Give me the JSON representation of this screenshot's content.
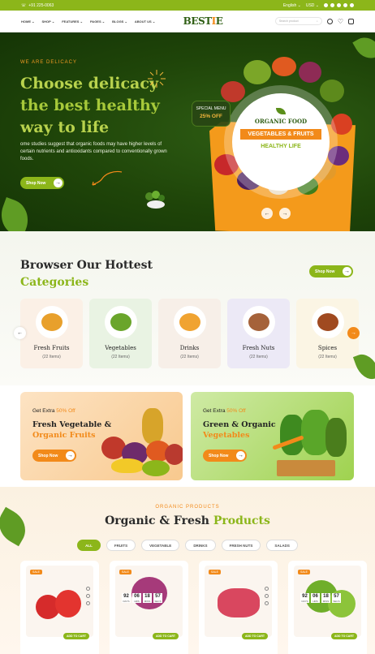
{
  "topbar": {
    "phone": "+91 225-0063",
    "language": "English",
    "currency": "USD"
  },
  "nav": {
    "items": [
      "HOME",
      "SHOP",
      "FEATURES",
      "PAGES",
      "BLOGS",
      "ABOUT US"
    ],
    "logo": "BESTIE",
    "search_placeholder": "Search product"
  },
  "hero": {
    "eyebrow": "WE ARE DELICACY",
    "title_line1": "Choose delicacy",
    "title_line2": "the best healthy",
    "title_line3": "way to life",
    "description": "ome studies suggest that organic foods may have higher levels of certain nutrients and antioxidants compared to conventionally grown foods.",
    "shop_button": "Shop Now",
    "plate_line1": "ORGANIC FOOD",
    "plate_line2": "VEGETABLES & FRUITS",
    "plate_line3": "HEALTHY LIFE",
    "special_label": "SPECIAL MENU",
    "special_value": "25% OFF"
  },
  "categories": {
    "title_line1": "Browser Our Hottest",
    "title_line2": "Categories",
    "shop_button": "Shop Now",
    "items": [
      {
        "name": "Fresh Fruits",
        "count": "(22 Items)",
        "bg": "#fbf0e6",
        "color": "#e8a02c"
      },
      {
        "name": "Vegetables",
        "count": "(22 Items)",
        "bg": "#e9f3e3",
        "color": "#6aa52b"
      },
      {
        "name": "Drinks",
        "count": "(22 Items)",
        "bg": "#f7efe8",
        "color": "#f0a331"
      },
      {
        "name": "Fresh Nuts",
        "count": "(22 Items)",
        "bg": "#ece9f6",
        "color": "#a5623a"
      },
      {
        "name": "Spices",
        "count": "(22 Items)",
        "bg": "#fbf5e4",
        "color": "#a04a20"
      }
    ]
  },
  "promos": [
    {
      "extra": "Get Extra",
      "percent": "50% Off",
      "line1": "Fresh Vegetable &",
      "line2": "Organic Fruits",
      "button": "Shop Now"
    },
    {
      "extra": "Get Extra",
      "percent": "50% Off",
      "line1": "Green & Organic",
      "line2": "Vegetables",
      "button": "Shop Now"
    }
  ],
  "products": {
    "eyebrow": "ORGANIC PRODUCTS",
    "title_a": "Organic & Fresh",
    "title_b": "Products",
    "filters": [
      "ALL",
      "FRUITS",
      "VEGETABLE",
      "DRINKS",
      "FRESH NUTS",
      "SALADS"
    ],
    "sale_badge": "SALE",
    "add_to_cart": "ADD TO CART",
    "countdown": [
      {
        "value": "92",
        "unit": "DAYS"
      },
      {
        "value": "06",
        "unit": "HRS"
      },
      {
        "value": "18",
        "unit": "MINS"
      },
      {
        "value": "57",
        "unit": "SECS"
      }
    ]
  },
  "colors": {
    "brand_green": "#8cb61a",
    "accent_orange": "#f28a1a",
    "hero_dark": "#1f4509"
  }
}
